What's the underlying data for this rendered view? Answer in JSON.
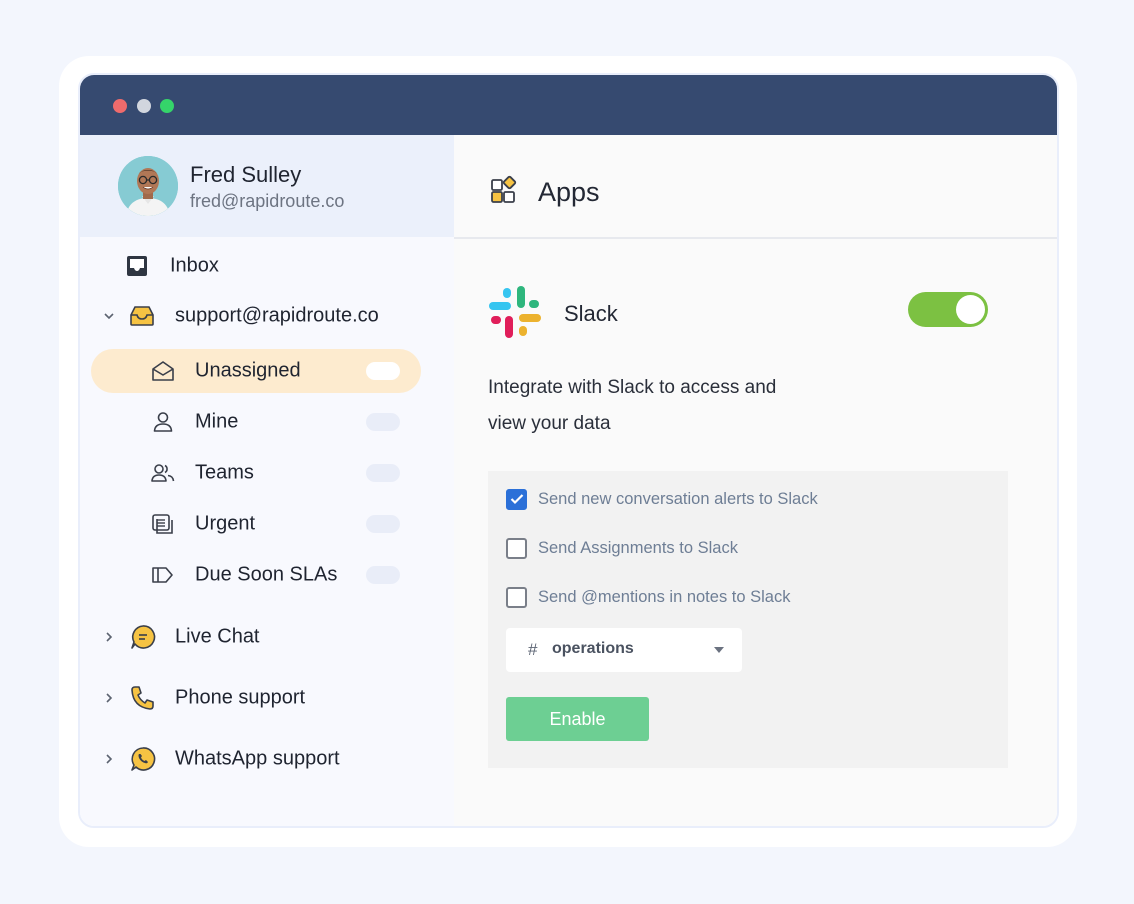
{
  "window": {
    "controls": [
      "close",
      "minimize",
      "maximize"
    ]
  },
  "profile": {
    "name": "Fred Sulley",
    "email": "fred@rapidroute.co"
  },
  "sidebar": {
    "inbox_label": "Inbox",
    "mailbox_label": "support@rapidroute.co",
    "sub_items": [
      {
        "label": "Unassigned",
        "icon": "envelope-open-icon",
        "active": true
      },
      {
        "label": "Mine",
        "icon": "person-icon"
      },
      {
        "label": "Teams",
        "icon": "people-icon"
      },
      {
        "label": "Urgent",
        "icon": "stacked-cards-icon"
      },
      {
        "label": "Due Soon SLAs",
        "icon": "tag-icon"
      }
    ],
    "channels": [
      {
        "label": "Live Chat",
        "icon": "chat-bubble-icon"
      },
      {
        "label": "Phone support",
        "icon": "phone-icon"
      },
      {
        "label": "WhatsApp support",
        "icon": "whatsapp-icon"
      }
    ]
  },
  "main": {
    "title": "Apps",
    "integration": {
      "name": "Slack",
      "enabled": true,
      "description_line1": "Integrate with Slack to access and",
      "description_line2": "view your data"
    },
    "options": [
      {
        "label": "Send new conversation alerts to Slack",
        "checked": true
      },
      {
        "label": "Send Assignments to Slack",
        "checked": false
      },
      {
        "label": "Send @mentions in notes to Slack",
        "checked": false
      }
    ],
    "channel_select": {
      "prefix": "#",
      "value": "operations"
    },
    "enable_button": "Enable"
  },
  "colors": {
    "titlebar": "#364a70",
    "toggle_on": "#7cc142",
    "enable_button": "#6dcf93",
    "checkbox_checked": "#2b70d8",
    "active_item": "#fdebcf"
  }
}
